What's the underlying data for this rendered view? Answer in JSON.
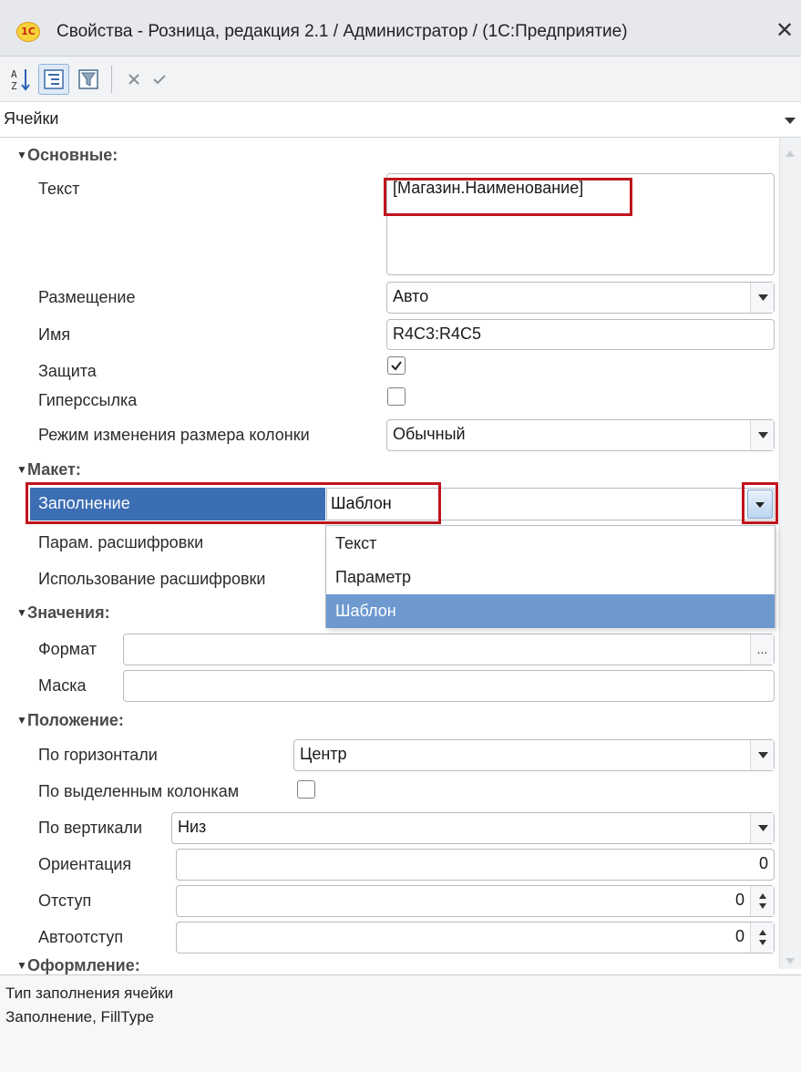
{
  "window": {
    "title": "Свойства - Розница, редакция 2.1 / Администратор / (1С:Предприятие)",
    "logo_text": "1С",
    "close_symbol": "✕"
  },
  "toolbar": {
    "icons": [
      "sort-alphabetical-icon",
      "categories-icon",
      "filter-icon",
      "cancel-icon",
      "apply-icon"
    ]
  },
  "section_selector": {
    "value": "Ячейки"
  },
  "groups": {
    "main": "Основные:",
    "layout": "Макет:",
    "values": "Значения:",
    "position": "Положение:",
    "design": "Оформление:"
  },
  "main": {
    "text_label": "Текст",
    "text_value": "[Магазин.Наименование]",
    "placement_label": "Размещение",
    "placement_value": "Авто",
    "name_label": "Имя",
    "name_value": "R4C3:R4C5",
    "protection_label": "Защита",
    "protection_checked": true,
    "hyperlink_label": "Гиперссылка",
    "hyperlink_checked": false,
    "resize_mode_label": "Режим изменения размера колонки",
    "resize_mode_value": "Обычный"
  },
  "layout": {
    "fill_label": "Заполнение",
    "fill_value": "Шаблон",
    "details_param_label": "Парам. расшифровки",
    "details_usage_label": "Использование расшифровки",
    "fill_options": [
      "Текст",
      "Параметр",
      "Шаблон"
    ],
    "fill_selected": "Шаблон"
  },
  "values": {
    "format_label": "Формат",
    "format_value": "",
    "format_button": "...",
    "mask_label": "Маска",
    "mask_value": ""
  },
  "position": {
    "horizontal_label": "По горизонтали",
    "horizontal_value": "Центр",
    "by_selected_columns_label": "По выделенным колонкам",
    "by_selected_columns_checked": false,
    "vertical_label": "По вертикали",
    "vertical_value": "Низ",
    "orientation_label": "Ориентация",
    "orientation_value": "0",
    "indent_label": "Отступ",
    "indent_value": "0",
    "auto_indent_label": "Автоотступ",
    "auto_indent_value": "0"
  },
  "description": {
    "line1": "Тип заполнения ячейки",
    "line2": "Заполнение, FillType"
  },
  "colors": {
    "selected_row_bg": "#3c6eb4",
    "selected_option_bg": "#6d99cf",
    "highlight_border": "#c0141c"
  }
}
